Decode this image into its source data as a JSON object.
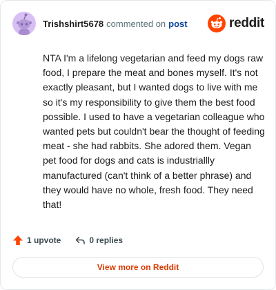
{
  "header": {
    "username": "Trishshirt5678",
    "action_text": "commented on",
    "post_link": "post",
    "brand": "reddit",
    "avatar_icon": "snoo-avatar-icon",
    "brand_icon": "reddit-logo-icon"
  },
  "comment": {
    "body": "NTA I'm a lifelong vegetarian and feed my dogs raw food, I prepare the meat and bones myself. It's not exactly pleasant, but I wanted dogs to live with me so it's my responsibility to give them the best food possible. I used to have a vegetarian colleague who wanted pets but couldn't bear the thought of feeding meat - she had rabbits. She adored them. Vegan pet food for dogs and cats is industriallly manufactured (can't think of a better phrase) and they would have no whole, fresh food. They need that!"
  },
  "actions": {
    "upvote_label": "1 upvote",
    "reply_label": "0 replies",
    "upvote_icon": "upvote-arrow-icon",
    "reply_icon": "reply-arrow-icon"
  },
  "footer": {
    "view_more_label": "View more on Reddit"
  },
  "colors": {
    "brand_orange": "#ff4500",
    "link_blue": "#0a449b",
    "view_more_text": "#d93a00",
    "avatar_bg": "#d7bff3"
  }
}
